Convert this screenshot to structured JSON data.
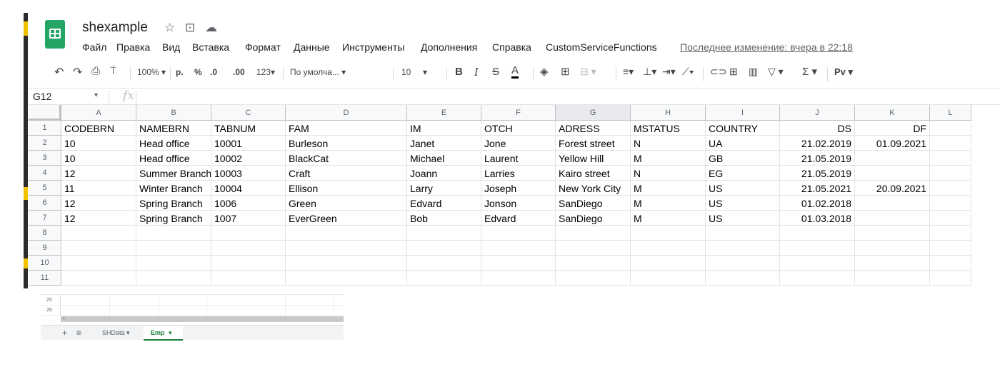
{
  "app": {
    "doc_title": "shexample",
    "menu": [
      "Файл",
      "Правка",
      "Вид",
      "Вставка",
      "Формат",
      "Данные",
      "Инструменты",
      "Дополнения",
      "Справка",
      "CustomServiceFunctions"
    ],
    "last_edit": "Последнее изменение: вчера в 22:18"
  },
  "toolbar": {
    "zoom": "100%",
    "currency": "р.",
    "percent": "%",
    "dec_less": ".0",
    "dec_more": ".00",
    "format_more": "123",
    "font": "По умолча...",
    "font_size": "10",
    "bold": "B",
    "italic": "I",
    "strike": "S",
    "text_color": "A",
    "functions": "Σ",
    "extension": "Pv"
  },
  "formula_bar": {
    "cell_ref": "G12",
    "fx": "fx"
  },
  "grid": {
    "columns": [
      "A",
      "B",
      "C",
      "D",
      "E",
      "F",
      "G",
      "H",
      "I",
      "J",
      "K",
      "L"
    ],
    "row_numbers": [
      "1",
      "2",
      "3",
      "4",
      "5",
      "6",
      "7",
      "8",
      "9",
      "10",
      "11"
    ],
    "rows": [
      [
        "CODEBRN",
        "NAMEBRN",
        "TABNUM",
        "FAM",
        "IM",
        "OTCH",
        "ADRESS",
        "MSTATUS",
        "COUNTRY",
        "DS",
        "DF",
        ""
      ],
      [
        "10",
        "Head office",
        "10001",
        "Burleson",
        "Janet",
        "Jone",
        "Forest street",
        "N",
        "UA",
        "21.02.2019",
        "01.09.2021",
        ""
      ],
      [
        "10",
        "Head office",
        "10002",
        "BlackCat",
        "Michael",
        "Laurent",
        "Yellow Hill",
        "M",
        "GB",
        "21.05.2019",
        "",
        ""
      ],
      [
        "12",
        "Summer Branch",
        "10003",
        "Craft",
        "Joann",
        "Larries",
        "Kairo street",
        "N",
        "EG",
        "21.05.2019",
        "",
        ""
      ],
      [
        "11",
        "Winter Branch",
        "10004",
        "Ellison",
        "Larry",
        "Joseph",
        "New York City",
        "M",
        "US",
        "21.05.2021",
        "20.09.2021",
        ""
      ],
      [
        "12",
        "Spring Branch",
        "1006",
        "Green",
        "Edvard",
        "Jonson",
        "SanDiego",
        "M",
        "US",
        "01.02.2018",
        "",
        ""
      ],
      [
        "12",
        "Spring Branch",
        "1007",
        "EverGreen",
        "Bob",
        "Edvard",
        "SanDiego",
        "M",
        "US",
        "01.03.2018",
        "",
        ""
      ],
      [
        "",
        "",
        "",
        "",
        "",
        "",
        "",
        "",
        "",
        "",
        "",
        ""
      ],
      [
        "",
        "",
        "",
        "",
        "",
        "",
        "",
        "",
        "",
        "",
        "",
        ""
      ],
      [
        "",
        "",
        "",
        "",
        "",
        "",
        "",
        "",
        "",
        "",
        "",
        ""
      ],
      [
        "",
        "",
        "",
        "",
        "",
        "",
        "",
        "",
        "",
        "",
        "",
        ""
      ]
    ]
  },
  "mini": {
    "row_numbers": [
      "25",
      "26"
    ],
    "tabs": [
      "SHData",
      "Emp"
    ],
    "active_tab": "Emp"
  },
  "colors": {
    "brand_green": "#23a566",
    "active_tab": "#188038",
    "grid_line": "#e2e3e3"
  },
  "icons": [
    "star-icon",
    "move-to-folder-icon",
    "cloud-status-icon",
    "undo-icon",
    "redo-icon",
    "print-icon",
    "paint-format-icon",
    "fill-color-icon",
    "borders-icon",
    "merge-icon",
    "align-icon",
    "valign-icon",
    "wrap-icon",
    "rotate-icon",
    "link-icon",
    "comment-icon",
    "chart-icon",
    "filter-icon",
    "add-sheet-icon",
    "all-sheets-icon"
  ]
}
